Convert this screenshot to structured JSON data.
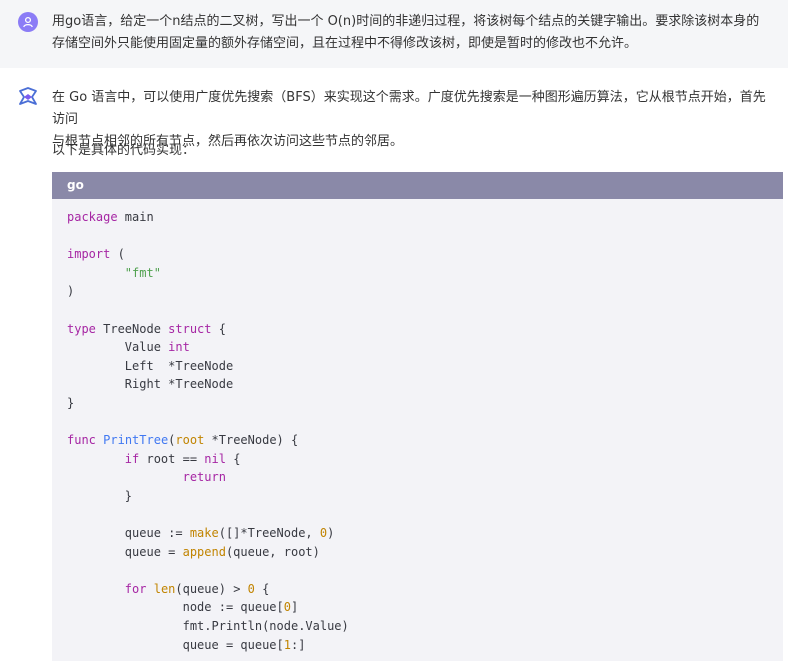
{
  "user_message": {
    "line1": "用go语言，给定一个n结点的二叉树，写出一个 O(n)时间的非递归过程，将该树每个结点的关键字输出。要求除该树本身的",
    "line2": "存储空间外只能使用固定量的额外存储空间，且在过程中不得修改该树，即使是暂时的修改也不允许。"
  },
  "assistant": {
    "para1_line1": "在 Go 语言中，可以使用广度优先搜索（BFS）来实现这个需求。广度优先搜索是一种图形遍历算法，它从根节点开始，首先访问",
    "para1_line2": "与根节点相邻的所有节点，然后再依次访问这些节点的邻居。",
    "para2": "以下是具体的代码实现：",
    "code_language": "go",
    "code_lines": [
      "package main",
      "",
      "import (",
      "        \"fmt\"",
      ")",
      "",
      "type TreeNode struct {",
      "        Value int",
      "        Left  *TreeNode",
      "        Right *TreeNode",
      "}",
      "",
      "func PrintTree(root *TreeNode) {",
      "        if root == nil {",
      "                return",
      "        }",
      "",
      "        queue := make([]*TreeNode, 0)",
      "        queue = append(queue, root)",
      "",
      "        for len(queue) > 0 {",
      "                node := queue[0]",
      "                fmt.Println(node.Value)",
      "                queue = queue[1:]"
    ]
  },
  "icons": {
    "user_avatar": "user-icon",
    "assistant_avatar": "assistant-logo-icon"
  },
  "colors": {
    "user_bg": "#f5f6f8",
    "code_header_bg": "#8a89a8",
    "code_bg": "#f3f3f7",
    "avatar_purple": "#8b7cf6"
  }
}
